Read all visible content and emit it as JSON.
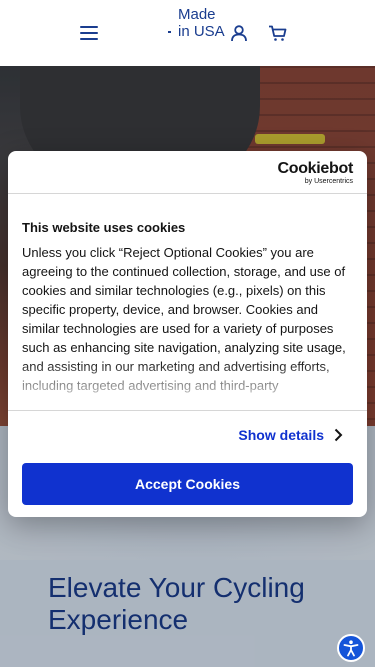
{
  "header": {
    "made_in": "Made in USA",
    "menu_icon": "hamburger-menu-icon",
    "account_icon": "user-icon",
    "cart_icon": "cart-icon"
  },
  "hero": {
    "heading": "Elevate Your Cycling Experience"
  },
  "cookie_banner": {
    "brand": "Cookiebot",
    "brand_by": "by Usercentrics",
    "title": "This website uses cookies",
    "body": "Unless you click “Reject Optional Cookies” you are agreeing to the continued collection, storage, and use of cookies and similar technologies (e.g., pixels) on this specific property, device, and browser. Cookies and similar technologies are used for a variety of purposes such as enhancing site navigation, analyzing site usage, and assisting in our marketing and advertising efforts, including targeted advertising and third-party",
    "show_details_label": "Show details",
    "accept_label": "Accept Cookies"
  },
  "accessibility": {
    "icon": "accessibility-icon"
  },
  "colors": {
    "brand_blue": "#1a3d8f",
    "cookiebot_blue": "#1032cf",
    "accessibility_blue": "#1454d9"
  }
}
